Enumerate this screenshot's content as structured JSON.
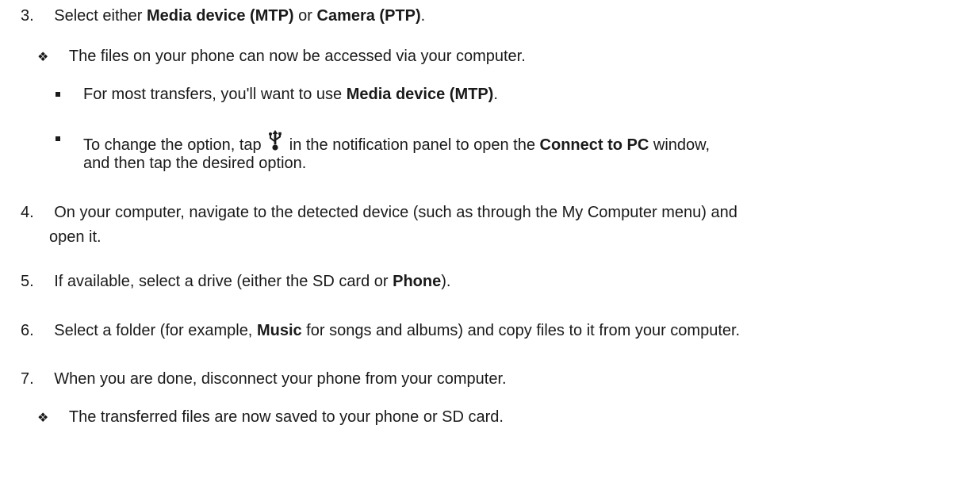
{
  "steps": {
    "s3": {
      "number": "3.",
      "t1": "Select either ",
      "b1": "Media device (MTP)",
      "t2": " or ",
      "b2": "Camera (PTP)",
      "t3": "."
    },
    "s3_result": {
      "symbol": "❖",
      "text": "The files on your phone can now be accessed via your computer."
    },
    "s3_sub1": {
      "t1": "For most transfers, you'll want to use ",
      "b1": "Media device (MTP)",
      "t2": "."
    },
    "s3_sub2": {
      "t1": "To change the option, tap ",
      "icon": "usb-icon",
      "t2": " in the notification panel to open the ",
      "b1": "Connect to PC",
      "t3": " window,",
      "line2": "and then tap the desired option."
    },
    "s4": {
      "number": "4.",
      "line1": "On your computer, navigate to the detected device (such as through the My Computer menu) and",
      "line2": "open it."
    },
    "s5": {
      "number": "5.",
      "t1": "If available, select a drive (either the SD card or ",
      "b1": "Phone",
      "t2": ")."
    },
    "s6": {
      "number": "6.",
      "t1": "Select a folder (for example, ",
      "b1": "Music",
      "t2": " for songs and albums) and copy files to it from your computer."
    },
    "s7": {
      "number": "7.",
      "text": "When you are done, disconnect your phone from your computer."
    },
    "s7_result": {
      "symbol": "❖",
      "text": "The transferred files are now saved to your phone or SD card."
    }
  }
}
